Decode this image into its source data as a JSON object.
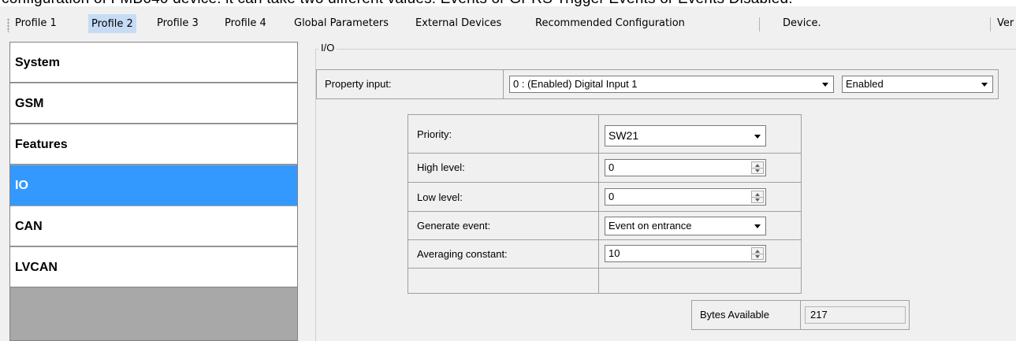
{
  "top_text": "configuration of FMB640 device: it can take two different values: Events or GPRS Trigger Events or Events Disabled.",
  "menu": {
    "items": [
      "Profile 1",
      "Profile 2",
      "Profile 3",
      "Profile 4",
      "Global Parameters",
      "External Devices",
      "Recommended Configuration",
      "Device.",
      "Ver"
    ],
    "active": "Profile 2"
  },
  "sidebar": {
    "items": [
      "System",
      "GSM",
      "Features",
      "IO",
      "CAN",
      "LVCAN"
    ],
    "selected": "IO"
  },
  "panel": {
    "group_title": "I/O",
    "property_input_label": "Property input:",
    "property_input_value": "0 : (Enabled) Digital Input 1",
    "enabled_value": "Enabled",
    "fields": {
      "priority_label": "Priority:",
      "priority_value": "SW21",
      "high_level_label": "High level:",
      "high_level_value": "0",
      "low_level_label": "Low level:",
      "low_level_value": "0",
      "generate_event_label": "Generate event:",
      "generate_event_value": "Event on entrance",
      "averaging_label": "Averaging constant:",
      "averaging_value": "10"
    },
    "bytes_label": "Bytes Available",
    "bytes_value": "217"
  },
  "colors": {
    "selected_bg": "#3399ff",
    "menu_active_bg": "#c6dcf5",
    "sidebar_empty_bg": "#a8a8a8"
  }
}
